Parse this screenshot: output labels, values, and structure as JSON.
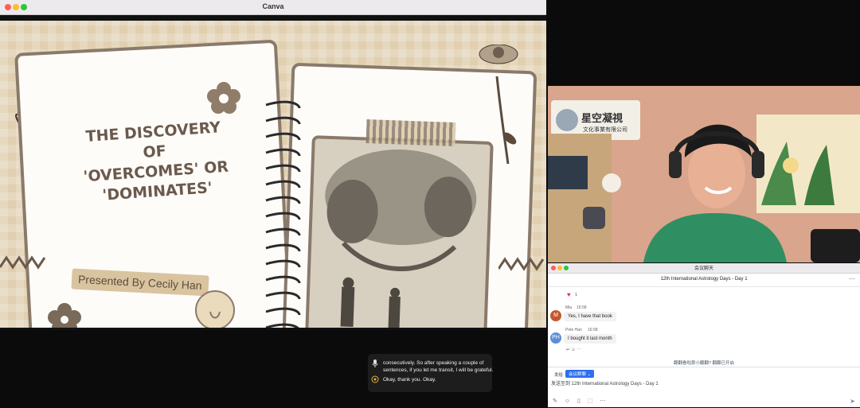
{
  "canva_window": {
    "title": "Canva"
  },
  "slide": {
    "title": "THE DISCOVERY OF\n'OVERCOMES' OR\n'DOMINATES'",
    "presenter": "Presented By Cecily Han"
  },
  "captions": {
    "line1": "consecutively. So after speaking a couple of sentences, if you let me transit, I will be grateful.",
    "line2": "Okay, thank you. Okay."
  },
  "video": {
    "sign_text": "星空凝視",
    "sign_subtext": "文化事業有限公司"
  },
  "chat": {
    "window_title": "会议聊天",
    "header_title": "12th International Astrology Days - Day 1",
    "reaction_count": "1",
    "messages": [
      {
        "avatar": "M",
        "avatar_color": "#c4572f",
        "sender": "Mia",
        "time": "16:58",
        "text": "Yes, I have that book"
      },
      {
        "avatar": "PH",
        "avatar_color": "#5b8ed6",
        "sender": "Pete Han",
        "time": "16:58",
        "text": "I bought it last month"
      }
    ],
    "translate_banner": "翻翻看啦那小翻翻?  翻翻已开启",
    "to_label": "发给",
    "to_value": "会议群聊 ⌄",
    "compose_text": "发送至到 12th International Astrology Days - Day 1"
  }
}
